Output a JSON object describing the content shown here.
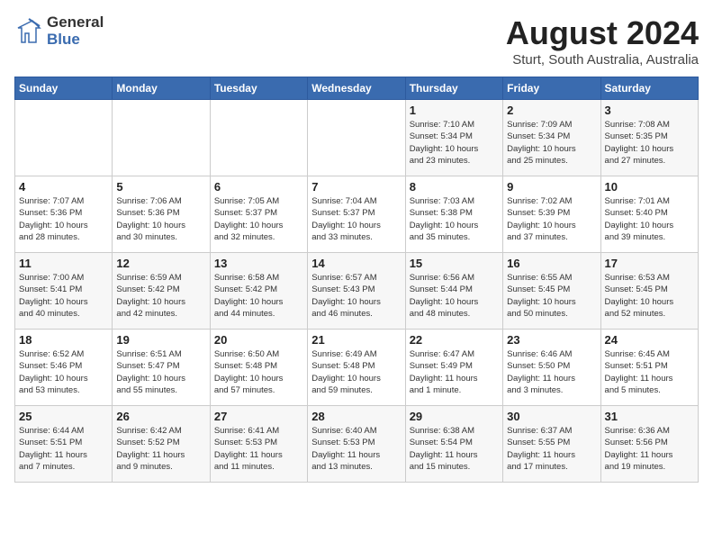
{
  "header": {
    "logo_general": "General",
    "logo_blue": "Blue",
    "month_year": "August 2024",
    "location": "Sturt, South Australia, Australia"
  },
  "days_of_week": [
    "Sunday",
    "Monday",
    "Tuesday",
    "Wednesday",
    "Thursday",
    "Friday",
    "Saturday"
  ],
  "weeks": [
    [
      {
        "day": "",
        "info": ""
      },
      {
        "day": "",
        "info": ""
      },
      {
        "day": "",
        "info": ""
      },
      {
        "day": "",
        "info": ""
      },
      {
        "day": "1",
        "info": "Sunrise: 7:10 AM\nSunset: 5:34 PM\nDaylight: 10 hours\nand 23 minutes."
      },
      {
        "day": "2",
        "info": "Sunrise: 7:09 AM\nSunset: 5:34 PM\nDaylight: 10 hours\nand 25 minutes."
      },
      {
        "day": "3",
        "info": "Sunrise: 7:08 AM\nSunset: 5:35 PM\nDaylight: 10 hours\nand 27 minutes."
      }
    ],
    [
      {
        "day": "4",
        "info": "Sunrise: 7:07 AM\nSunset: 5:36 PM\nDaylight: 10 hours\nand 28 minutes."
      },
      {
        "day": "5",
        "info": "Sunrise: 7:06 AM\nSunset: 5:36 PM\nDaylight: 10 hours\nand 30 minutes."
      },
      {
        "day": "6",
        "info": "Sunrise: 7:05 AM\nSunset: 5:37 PM\nDaylight: 10 hours\nand 32 minutes."
      },
      {
        "day": "7",
        "info": "Sunrise: 7:04 AM\nSunset: 5:37 PM\nDaylight: 10 hours\nand 33 minutes."
      },
      {
        "day": "8",
        "info": "Sunrise: 7:03 AM\nSunset: 5:38 PM\nDaylight: 10 hours\nand 35 minutes."
      },
      {
        "day": "9",
        "info": "Sunrise: 7:02 AM\nSunset: 5:39 PM\nDaylight: 10 hours\nand 37 minutes."
      },
      {
        "day": "10",
        "info": "Sunrise: 7:01 AM\nSunset: 5:40 PM\nDaylight: 10 hours\nand 39 minutes."
      }
    ],
    [
      {
        "day": "11",
        "info": "Sunrise: 7:00 AM\nSunset: 5:41 PM\nDaylight: 10 hours\nand 40 minutes."
      },
      {
        "day": "12",
        "info": "Sunrise: 6:59 AM\nSunset: 5:42 PM\nDaylight: 10 hours\nand 42 minutes."
      },
      {
        "day": "13",
        "info": "Sunrise: 6:58 AM\nSunset: 5:42 PM\nDaylight: 10 hours\nand 44 minutes."
      },
      {
        "day": "14",
        "info": "Sunrise: 6:57 AM\nSunset: 5:43 PM\nDaylight: 10 hours\nand 46 minutes."
      },
      {
        "day": "15",
        "info": "Sunrise: 6:56 AM\nSunset: 5:44 PM\nDaylight: 10 hours\nand 48 minutes."
      },
      {
        "day": "16",
        "info": "Sunrise: 6:55 AM\nSunset: 5:45 PM\nDaylight: 10 hours\nand 50 minutes."
      },
      {
        "day": "17",
        "info": "Sunrise: 6:53 AM\nSunset: 5:45 PM\nDaylight: 10 hours\nand 52 minutes."
      }
    ],
    [
      {
        "day": "18",
        "info": "Sunrise: 6:52 AM\nSunset: 5:46 PM\nDaylight: 10 hours\nand 53 minutes."
      },
      {
        "day": "19",
        "info": "Sunrise: 6:51 AM\nSunset: 5:47 PM\nDaylight: 10 hours\nand 55 minutes."
      },
      {
        "day": "20",
        "info": "Sunrise: 6:50 AM\nSunset: 5:48 PM\nDaylight: 10 hours\nand 57 minutes."
      },
      {
        "day": "21",
        "info": "Sunrise: 6:49 AM\nSunset: 5:48 PM\nDaylight: 10 hours\nand 59 minutes."
      },
      {
        "day": "22",
        "info": "Sunrise: 6:47 AM\nSunset: 5:49 PM\nDaylight: 11 hours\nand 1 minute."
      },
      {
        "day": "23",
        "info": "Sunrise: 6:46 AM\nSunset: 5:50 PM\nDaylight: 11 hours\nand 3 minutes."
      },
      {
        "day": "24",
        "info": "Sunrise: 6:45 AM\nSunset: 5:51 PM\nDaylight: 11 hours\nand 5 minutes."
      }
    ],
    [
      {
        "day": "25",
        "info": "Sunrise: 6:44 AM\nSunset: 5:51 PM\nDaylight: 11 hours\nand 7 minutes."
      },
      {
        "day": "26",
        "info": "Sunrise: 6:42 AM\nSunset: 5:52 PM\nDaylight: 11 hours\nand 9 minutes."
      },
      {
        "day": "27",
        "info": "Sunrise: 6:41 AM\nSunset: 5:53 PM\nDaylight: 11 hours\nand 11 minutes."
      },
      {
        "day": "28",
        "info": "Sunrise: 6:40 AM\nSunset: 5:53 PM\nDaylight: 11 hours\nand 13 minutes."
      },
      {
        "day": "29",
        "info": "Sunrise: 6:38 AM\nSunset: 5:54 PM\nDaylight: 11 hours\nand 15 minutes."
      },
      {
        "day": "30",
        "info": "Sunrise: 6:37 AM\nSunset: 5:55 PM\nDaylight: 11 hours\nand 17 minutes."
      },
      {
        "day": "31",
        "info": "Sunrise: 6:36 AM\nSunset: 5:56 PM\nDaylight: 11 hours\nand 19 minutes."
      }
    ]
  ]
}
